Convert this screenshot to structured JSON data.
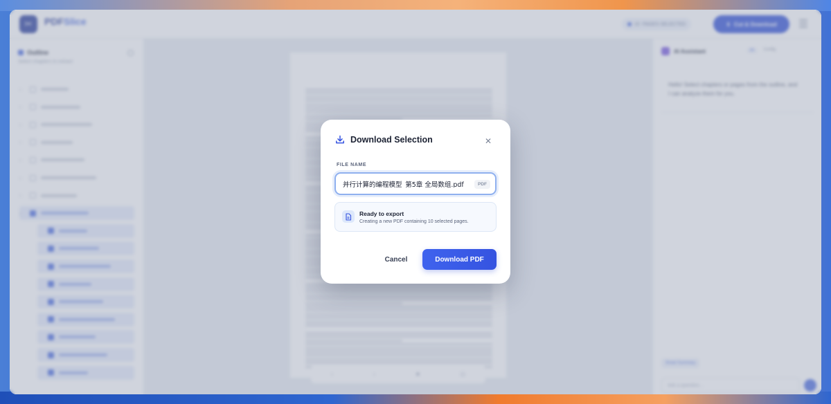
{
  "app": {
    "brand_name": "PDF",
    "brand_accent": "Slice",
    "pages_selected": "PAGES SELECTED",
    "pages_count": "10",
    "cut_download_label": "Cut & Download"
  },
  "sidebar": {
    "title": "Outline",
    "subtitle": "Select chapters to extract"
  },
  "assistant": {
    "title": "AI Assistant",
    "tab_active": "AI",
    "tab_other": "Config",
    "message": "Hello! Select chapters or pages from the outline, and I can analyze them for you.",
    "summary_chip": "Smart Summary",
    "input_placeholder": "Ask a question..."
  },
  "modal": {
    "title": "Download Selection",
    "file_name_label": "FILE NAME",
    "file_name_value": "并行计算的编程模型_第5章 全局数组.pdf",
    "extension_badge": "PDF",
    "info_heading": "Ready to export",
    "info_text": "Creating a new PDF containing 10 selected pages.",
    "cancel_label": "Cancel",
    "download_label": "Download PDF"
  },
  "colors": {
    "primary": "#3553e0",
    "focus_ring": "#8fb0ef"
  }
}
